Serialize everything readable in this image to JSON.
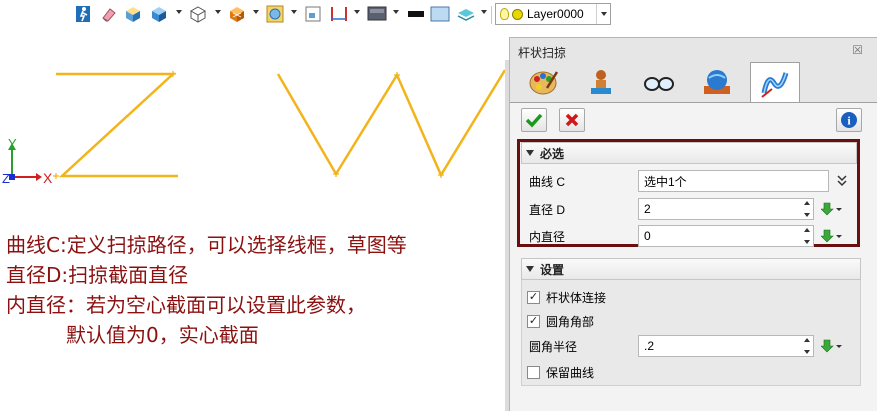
{
  "toolbar": {
    "icons": [
      "exit-icon",
      "eraser-icon",
      "shaded-cube-icon",
      "blue-cube-icon",
      "wireframe-cube-icon",
      "orange-cube-icon",
      "zoom-fit-icon",
      "view-box-icon",
      "dimension-icon",
      "display-mode-icon",
      "line-color-icon",
      "face-color-icon",
      "style-icon",
      "lightbulb-icon"
    ],
    "layer": {
      "name": "Layer0000",
      "bulb_color": "#f5e24a",
      "dot_color": "#e8d800"
    }
  },
  "canvas": {
    "curve_color": "#f2b41a",
    "axes": {
      "y_label": "Y",
      "x_label": "X",
      "z_label": "Z"
    }
  },
  "notes": {
    "line1": "曲线C:定义扫掠路径，可以选择线框，草图等",
    "line2": "直径D:扫掠截面直径",
    "line3": "内直径：若为空心截面可以设置此参数，",
    "line4": "默认值为0，实心截面",
    "color": "#8b1111"
  },
  "panel": {
    "title": "杆状扫掠",
    "close": "☒",
    "tabs": [
      "palette-tab-icon",
      "stamp-tab-icon",
      "glasses-tab-icon",
      "globe-tab-icon",
      "sweep-tab-icon"
    ],
    "required": {
      "header": "必选",
      "rows": [
        {
          "label": "曲线 C",
          "value": "选中1个"
        },
        {
          "label": "直径 D",
          "value": "2"
        },
        {
          "label": "内直径",
          "value": "0"
        }
      ]
    },
    "settings": {
      "header": "设置",
      "options": [
        {
          "label": "杆状体连接",
          "checked": true
        },
        {
          "label": "圆角角部",
          "checked": true
        }
      ],
      "radius": {
        "label": "圆角半径",
        "value": ".2"
      },
      "keep_curve": {
        "label": "保留曲线",
        "checked": false
      }
    },
    "frame_color": "#6a0f0f"
  }
}
